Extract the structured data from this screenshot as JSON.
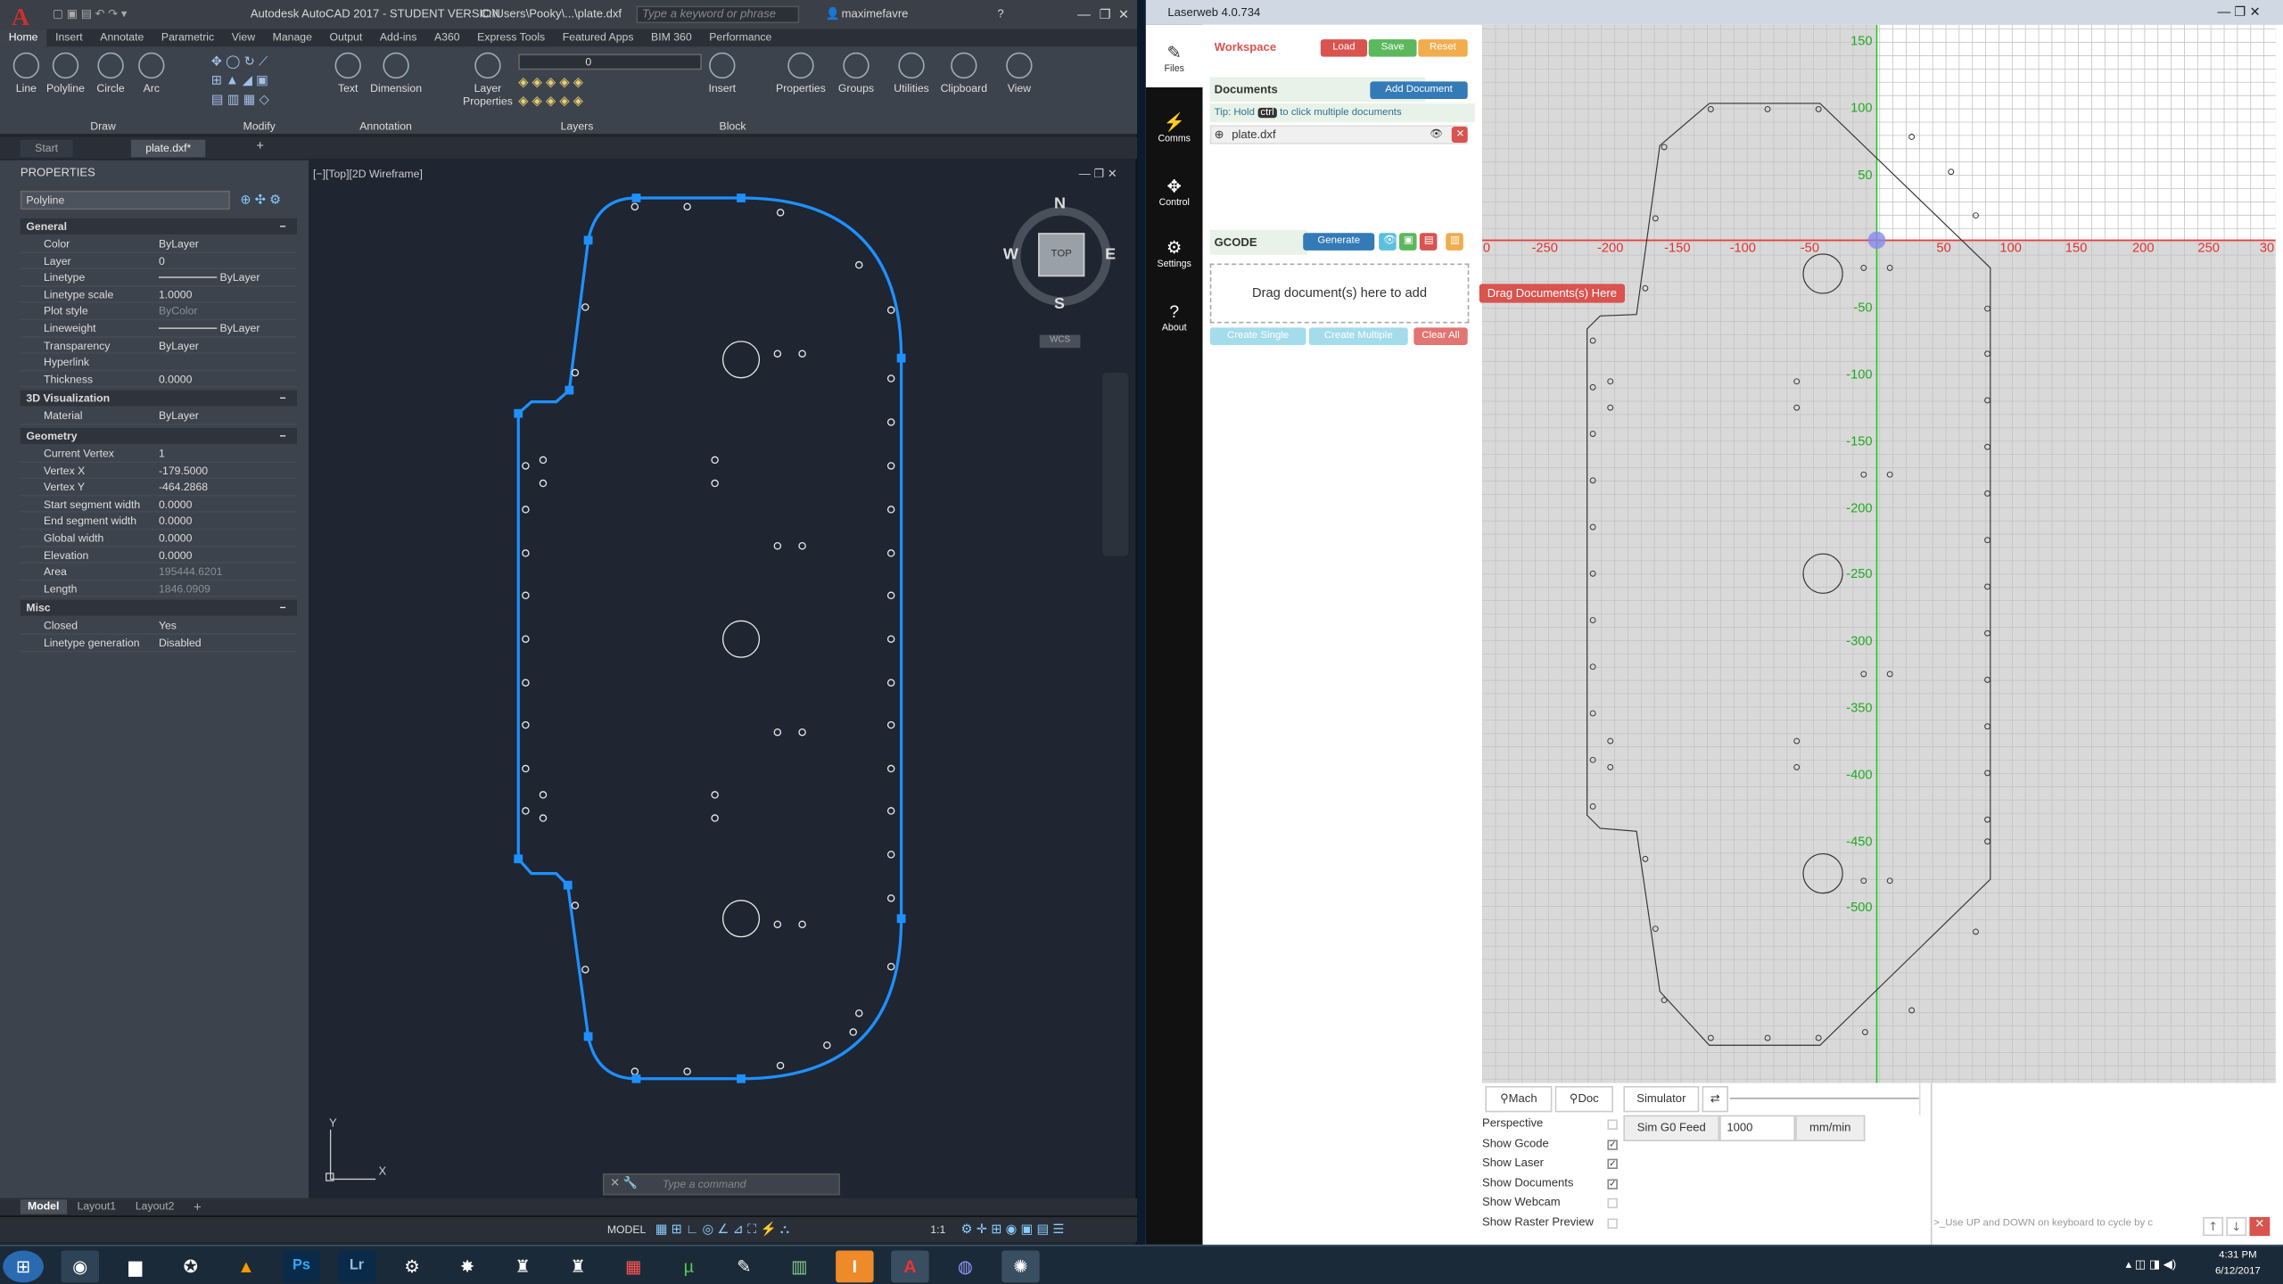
{
  "autocad": {
    "title": "Autodesk AutoCAD 2017 - STUDENT VERSION",
    "path": "C:\\Users\\Pooky\\...\\plate.dxf",
    "search_placeholder": "Type a keyword or phrase",
    "user": "maximefavre",
    "tabs": [
      "Home",
      "Insert",
      "Annotate",
      "Parametric",
      "View",
      "Manage",
      "Output",
      "Add-ins",
      "A360",
      "Express Tools",
      "Featured Apps",
      "BIM 360",
      "Performance"
    ],
    "tools": [
      "Line",
      "Polyline",
      "Circle",
      "Arc",
      "Text",
      "Dimension",
      "Layer Properties",
      "Insert",
      "Properties",
      "Groups",
      "Utilities",
      "Clipboard",
      "View"
    ],
    "panels": [
      "Draw",
      "Modify",
      "Annotation",
      "Layers",
      "Block"
    ],
    "layer_value": "0",
    "doc_tabs": [
      "Start",
      "plate.dxf*"
    ],
    "properties": {
      "title": "PROPERTIES",
      "selected": "Polyline",
      "general_label": "General",
      "viz_label": "3D Visualization",
      "geom_label": "Geometry",
      "misc_label": "Misc",
      "general": [
        [
          "Color",
          "ByLayer"
        ],
        [
          "Layer",
          "0"
        ],
        [
          "Linetype",
          "ByLayer"
        ],
        [
          "Linetype scale",
          "1.0000"
        ],
        [
          "Plot style",
          "ByColor"
        ],
        [
          "Lineweight",
          "ByLayer"
        ],
        [
          "Transparency",
          "ByLayer"
        ],
        [
          "Hyperlink",
          ""
        ],
        [
          "Thickness",
          "0.0000"
        ]
      ],
      "viz": [
        [
          "Material",
          "ByLayer"
        ]
      ],
      "geometry": [
        [
          "Current Vertex",
          "1"
        ],
        [
          "Vertex X",
          "-179.5000"
        ],
        [
          "Vertex Y",
          "-464.2868"
        ],
        [
          "Start segment width",
          "0.0000"
        ],
        [
          "End segment width",
          "0.0000"
        ],
        [
          "Global width",
          "0.0000"
        ],
        [
          "Elevation",
          "0.0000"
        ],
        [
          "Area",
          "195444.6201"
        ],
        [
          "Length",
          "1846.0909"
        ]
      ],
      "misc": [
        [
          "Closed",
          "Yes"
        ],
        [
          "Linetype generation",
          "Disabled"
        ]
      ]
    },
    "viewport_label": "[−][Top][2D Wireframe]",
    "viewcube": {
      "n": "N",
      "s": "S",
      "e": "E",
      "w": "W",
      "top": "TOP",
      "wcs": "WCS"
    },
    "command_placeholder": "Type a command",
    "layouts": [
      "Model",
      "Layout1",
      "Layout2"
    ],
    "status_model": "MODEL",
    "status_scale": "1:1"
  },
  "laserweb": {
    "title": "Laserweb 4.0.734",
    "nav": [
      "Files",
      "Comms",
      "Control",
      "Settings",
      "About"
    ],
    "workspace": "Workspace",
    "load": "Load",
    "save": "Save",
    "reset": "Reset",
    "documents": "Documents",
    "add_document": "Add Document",
    "tip_prefix": "Tip: Hold",
    "tip_key": "ctrl",
    "tip_suffix": "to click multiple documents",
    "file": "plate.dxf",
    "gcode": "GCODE",
    "generate": "Generate",
    "drop_text": "Drag document(s) here to add",
    "drop_hint": "Drag Documents(s) Here",
    "create_single": "Create Single",
    "create_multiple": "Create Multiple",
    "clear_all": "Clear All",
    "x_ticks": [
      "0",
      "-250",
      "-200",
      "-150",
      "-100",
      "-50",
      "50",
      "100",
      "150",
      "200",
      "250",
      "30"
    ],
    "y_ticks": [
      "150",
      "100",
      "50",
      "-50",
      "-100",
      "-150",
      "-200",
      "-250",
      "-300",
      "-350",
      "-400",
      "-450",
      "-500"
    ],
    "mach": "Mach",
    "doc": "Doc",
    "simulator": "Simulator",
    "options": [
      "Perspective",
      "Show Gcode",
      "Show Laser",
      "Show Documents",
      "Show Webcam",
      "Show Raster Preview"
    ],
    "options_checked": [
      false,
      true,
      true,
      true,
      false,
      false
    ],
    "sim_feed_label": "Sim G0 Feed",
    "sim_feed_value": "1000",
    "sim_feed_unit": "mm/min",
    "console_hint": ">_Use UP and DOWN on keyboard to cycle by c"
  },
  "taskbar": {
    "time": "4:31 PM",
    "date": "6/12/2017"
  }
}
